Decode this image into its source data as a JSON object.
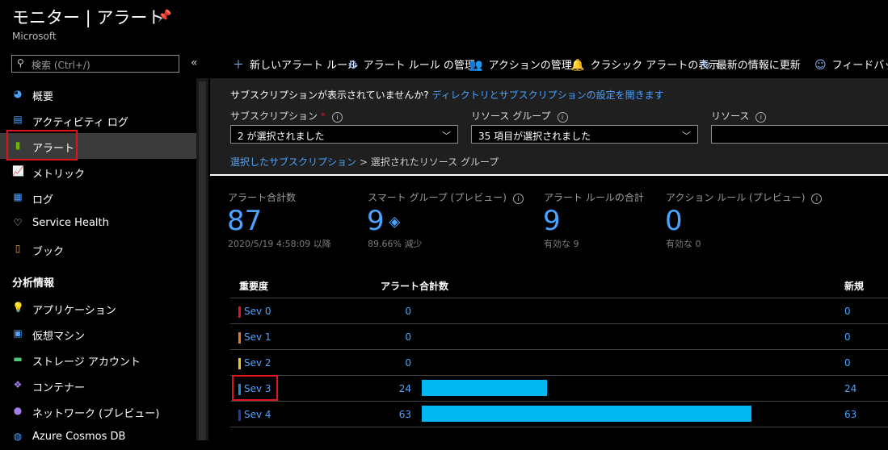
{
  "header": {
    "title": "モニター | アラート",
    "subtitle": "Microsoft"
  },
  "sidebar": {
    "search_placeholder": "検索 (Ctrl+/)",
    "collapse": "«",
    "items": [
      {
        "label": "概要",
        "icon": "overview-icon",
        "color": "#4aa3ff"
      },
      {
        "label": "アクティビティ ログ",
        "icon": "activity-log-icon",
        "color": "#4aa3ff"
      },
      {
        "label": "アラート",
        "icon": "alert-icon",
        "color": "#6bb700"
      },
      {
        "label": "メトリック",
        "icon": "metrics-icon",
        "color": "#4aa3ff"
      },
      {
        "label": "ログ",
        "icon": "logs-icon",
        "color": "#4aa3ff"
      },
      {
        "label": "Service Health",
        "icon": "heart-icon",
        "color": "#ffffff"
      },
      {
        "label": "ブック",
        "icon": "workbook-icon",
        "color": "#e8a33c"
      }
    ],
    "section_insights": "分析情報",
    "insight_items": [
      {
        "label": "アプリケーション",
        "icon": "bulb-icon",
        "color": "#a47ee8"
      },
      {
        "label": "仮想マシン",
        "icon": "vm-icon",
        "color": "#4aa3ff"
      },
      {
        "label": "ストレージ アカウント",
        "icon": "storage-icon",
        "color": "#50c878"
      },
      {
        "label": "コンテナー",
        "icon": "container-icon",
        "color": "#a47ee8"
      },
      {
        "label": "ネットワーク (プレビュー)",
        "icon": "network-icon",
        "color": "#a47ee8"
      },
      {
        "label": "Azure Cosmos DB",
        "icon": "cosmos-icon",
        "color": "#4aa3ff"
      }
    ]
  },
  "toolbar": {
    "new_rule": "新しいアラート ルール",
    "manage_rules": "アラート ルール の管理",
    "manage_actions": "アクションの管理",
    "classic": "クラシック アラートの表示",
    "refresh": "最新の情報に更新",
    "feedback": "フィードバックの"
  },
  "filters": {
    "notice_text": "サブスクリプションが表示されていませんか?",
    "notice_link": "ディレクトリとサブスクリプションの設定を開きます",
    "subscription_label": "サブスクリプション",
    "subscription_value": "2 が選択されました",
    "resource_group_label": "リソース グループ",
    "resource_group_value": "35 項目が選択されました",
    "resource_label": "リソース",
    "resource_value": "",
    "crumb_link": "選択したサブスクリプション",
    "crumb_sep": ">",
    "crumb_current": "選択されたリソース グループ"
  },
  "stats": [
    {
      "label": "アラート合計数",
      "value": "87",
      "sub": "2020/5/19 4:58:09 以降",
      "info": false
    },
    {
      "label": "スマート グループ (プレビュー)",
      "value": "9",
      "sub": "89.66% 減少",
      "info": true
    },
    {
      "label": "アラート ルールの合計",
      "value": "9",
      "sub": "有効な 9",
      "info": false
    },
    {
      "label": "アクション ルール (プレビュー)",
      "value": "0",
      "sub": "有効な 0",
      "info": true
    }
  ],
  "table": {
    "headers": {
      "severity": "重要度",
      "total": "アラート合計数",
      "new": "新規"
    },
    "max": 63,
    "rows": [
      {
        "name": "Sev 0",
        "total": 0,
        "new": "0",
        "color": "#e0141e"
      },
      {
        "name": "Sev 1",
        "total": 0,
        "new": "0",
        "color": "#e87722"
      },
      {
        "name": "Sev 2",
        "total": 0,
        "new": "0",
        "color": "#f2c811"
      },
      {
        "name": "Sev 3",
        "total": 24,
        "new": "24",
        "color": "#1e88e5"
      },
      {
        "name": "Sev 4",
        "total": 63,
        "new": "63",
        "color": "#1a3ea8"
      }
    ]
  }
}
